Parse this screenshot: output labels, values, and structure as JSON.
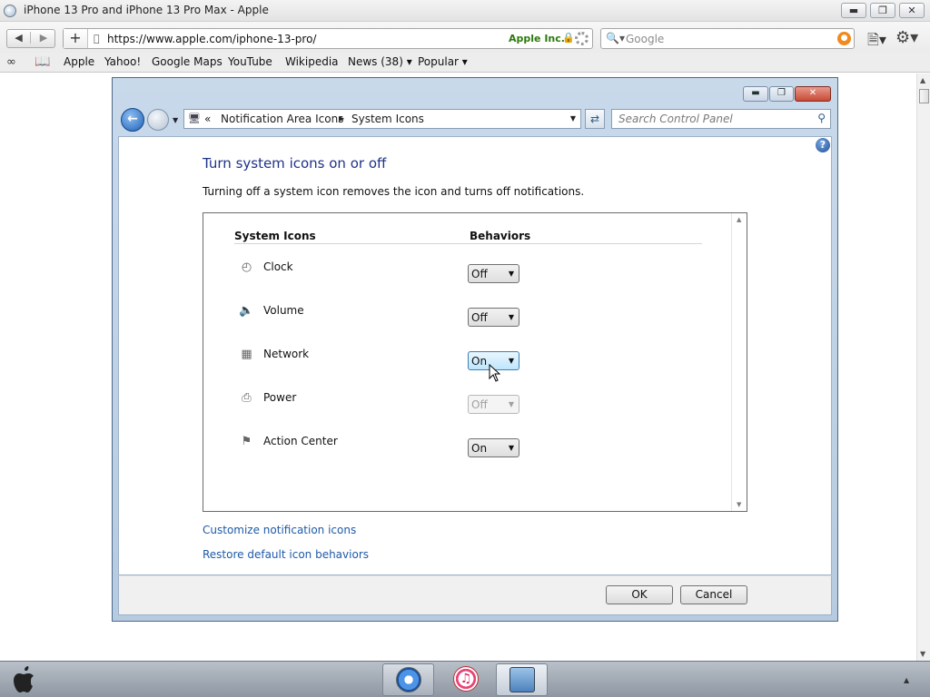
{
  "browser": {
    "title": "iPhone 13 Pro and iPhone 13 Pro Max - Apple",
    "controls": {
      "minimize": "▬",
      "maximize": "❐",
      "close": "✕"
    },
    "nav": {
      "back": "◀",
      "forward": "▶"
    },
    "address": {
      "plus": "+",
      "url": "https://www.apple.com/iphone-13-pro/",
      "owner": "Apple Inc."
    },
    "search": {
      "placeholder": "Google"
    },
    "bookmarks": [
      "Apple",
      "Yahoo!",
      "Google Maps",
      "YouTube",
      "Wikipedia",
      "News (38) ▾",
      "Popular ▾"
    ]
  },
  "control_panel": {
    "breadcrumb": {
      "prefix": "«",
      "items": [
        "Notification Area Icons",
        "System Icons"
      ]
    },
    "search_placeholder": "Search Control Panel",
    "help_label": "?",
    "heading": "Turn system icons on or off",
    "description": "Turning off a system icon removes the icon and turns off notifications.",
    "columns": {
      "icons": "System Icons",
      "behaviors": "Behaviors"
    },
    "rows": [
      {
        "label": "Clock",
        "icon": "clock-icon",
        "value": "Off",
        "state": "normal"
      },
      {
        "label": "Volume",
        "icon": "volume-icon",
        "value": "Off",
        "state": "normal"
      },
      {
        "label": "Network",
        "icon": "network-icon",
        "value": "On",
        "state": "hover"
      },
      {
        "label": "Power",
        "icon": "power-icon",
        "value": "Off",
        "state": "disabled"
      },
      {
        "label": "Action Center",
        "icon": "action-center-flag-icon",
        "value": "On",
        "state": "normal"
      }
    ],
    "links": {
      "customize": "Customize notification icons",
      "restore": "Restore default icon behaviors"
    },
    "buttons": {
      "ok": "OK",
      "cancel": "Cancel"
    }
  },
  "colors": {
    "heading": "#1e3287",
    "link": "#1e5aa8",
    "window_frame": "#b6cbe0",
    "hover_select": "#bee6fd"
  }
}
